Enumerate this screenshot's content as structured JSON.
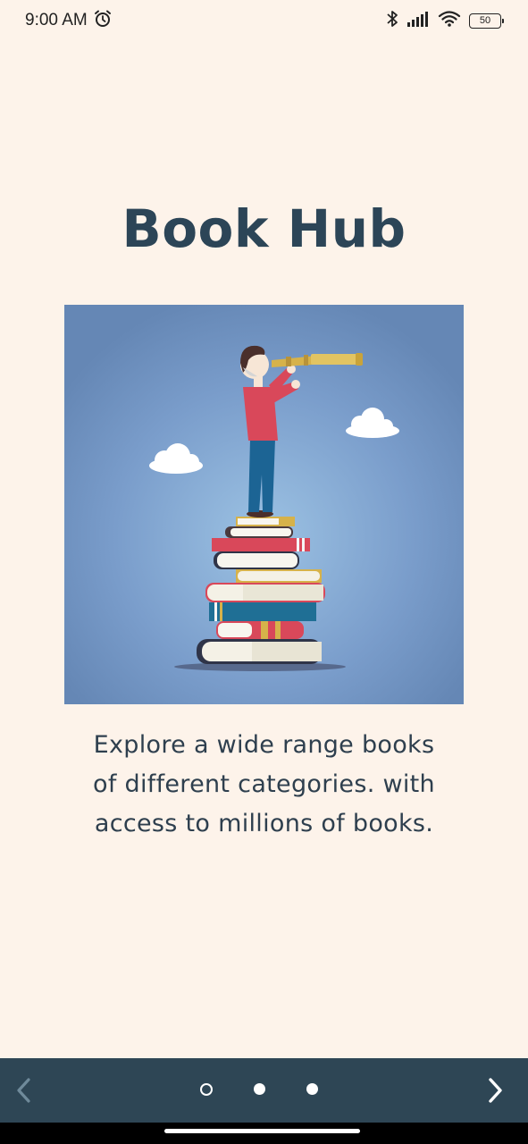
{
  "status_bar": {
    "time": "9:00 AM",
    "battery_level": "50",
    "icons": [
      "alarm-icon",
      "bluetooth-icon",
      "signal-icon",
      "wifi-icon",
      "battery-icon"
    ]
  },
  "onboarding": {
    "title": "Book Hub",
    "image_alt": "Person with telescope standing on a stack of books",
    "description_lines": [
      "Explore a wide range books",
      "of different categories. with",
      "access to millions of books."
    ]
  },
  "navigation": {
    "prev_icon": "chevron-left-icon",
    "next_icon": "chevron-right-icon",
    "page_count": 3,
    "current_page_index": 0
  },
  "colors": {
    "background": "#fdf3ea",
    "title": "#2c4557",
    "bottom_bar": "#2e4655",
    "image_bg": "#7097c4"
  }
}
